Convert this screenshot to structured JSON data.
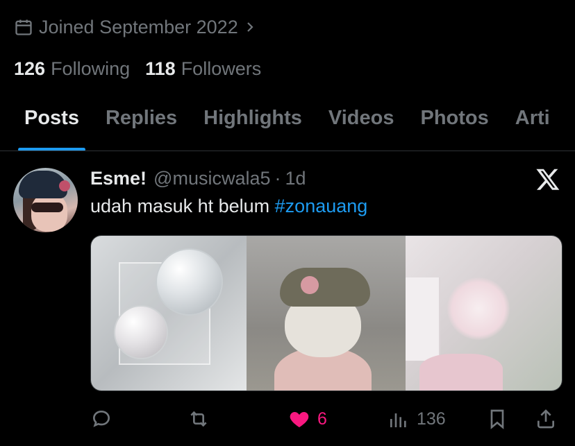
{
  "profile": {
    "joined_text": "Joined September 2022",
    "following_count": "126",
    "following_label": "Following",
    "followers_count": "118",
    "followers_label": "Followers"
  },
  "tabs": [
    {
      "label": "Posts",
      "active": true
    },
    {
      "label": "Replies",
      "active": false
    },
    {
      "label": "Highlights",
      "active": false
    },
    {
      "label": "Videos",
      "active": false
    },
    {
      "label": "Photos",
      "active": false
    },
    {
      "label": "Arti",
      "active": false
    }
  ],
  "post": {
    "display_name": "Esme!",
    "handle": "@musicwala5",
    "separator": "·",
    "time": "1d",
    "text": "udah masuk ht belum ",
    "hashtag": "#zonauang",
    "actions": {
      "reply_icon": "reply-icon",
      "repost_icon": "repost-icon",
      "like_icon": "heart-icon",
      "like_count": "6",
      "views_icon": "views-icon",
      "view_count": "136",
      "bookmark_icon": "bookmark-icon",
      "share_icon": "share-icon"
    }
  },
  "colors": {
    "background": "#000000",
    "text_primary": "#e7e9ea",
    "text_secondary": "#71767b",
    "accent": "#1d9bf0",
    "like": "#f91880",
    "divider": "#2f3336"
  }
}
